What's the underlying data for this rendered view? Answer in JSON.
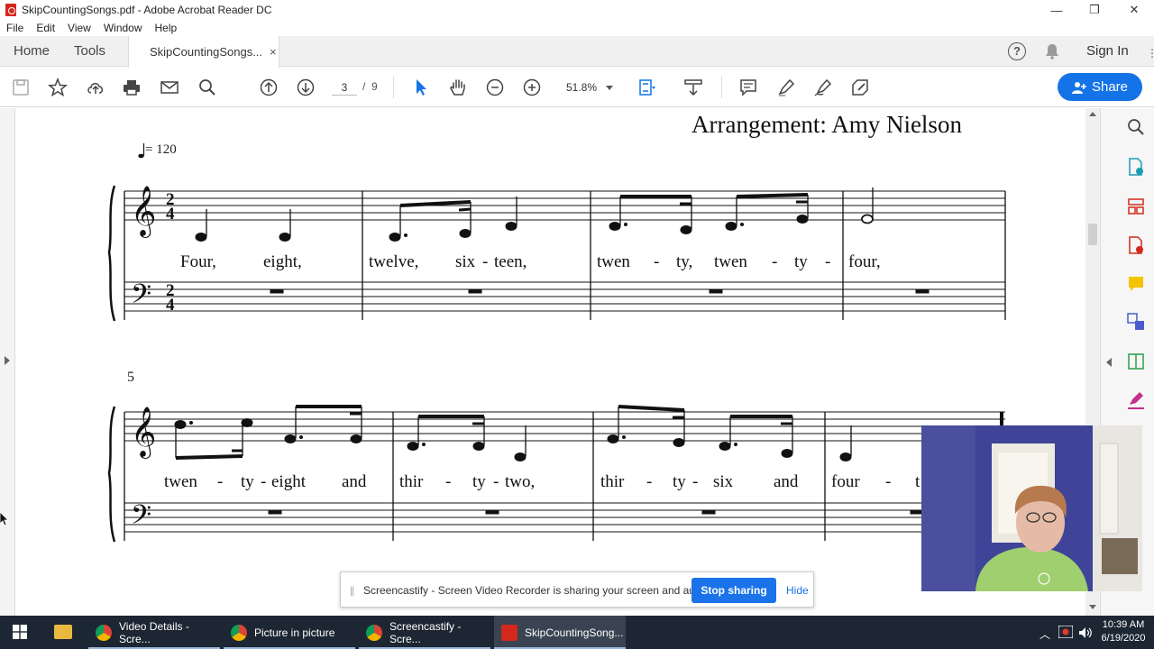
{
  "window": {
    "title": "SkipCountingSongs.pdf - Adobe Acrobat Reader DC",
    "minimize": "—",
    "maximize": "❐",
    "close": "✕"
  },
  "menu": [
    "File",
    "Edit",
    "View",
    "Window",
    "Help"
  ],
  "tabs": {
    "home": "Home",
    "tools": "Tools",
    "document": "SkipCountingSongs...",
    "close_symbol": "×"
  },
  "header_right": {
    "help_symbol": "?",
    "sign_in": "Sign In"
  },
  "toolbar": {
    "current_page": "3",
    "page_separator": "/",
    "total_pages": "9",
    "zoom": "51.8%",
    "share_label": "Share",
    "accent_color": "#1473e6"
  },
  "score": {
    "title": "Arrangement: Amy Nielson",
    "tempo": "= 120",
    "measure_number": "5",
    "row1_lyrics": [
      "Four,",
      "eight,",
      "twelve,",
      "six",
      "-",
      "teen,",
      "twen",
      "-",
      "ty,",
      "twen",
      "-",
      "ty",
      "-",
      "four,"
    ],
    "row2_lyrics": [
      "twen",
      "-",
      "ty",
      "-",
      "eight",
      "and",
      "thir",
      "-",
      "ty",
      "-",
      "two,",
      "thir",
      "-",
      "ty",
      "-",
      "six",
      "and",
      "four",
      "-",
      "t"
    ]
  },
  "notification": {
    "grip": "||",
    "message": "Screencastify - Screen Video Recorder is sharing your screen and audio.",
    "stop_label": "Stop sharing",
    "hide_label": "Hide"
  },
  "taskbar": {
    "items": [
      {
        "label": "Video Details - Scre...",
        "icon": "chrome-icon"
      },
      {
        "label": "Picture in picture",
        "icon": "chrome-icon"
      },
      {
        "label": "Screencastify - Scre...",
        "icon": "chrome-icon"
      },
      {
        "label": "SkipCountingSong...",
        "icon": "acrobat-icon"
      }
    ],
    "time": "10:39 AM",
    "date": "6/19/2020"
  }
}
